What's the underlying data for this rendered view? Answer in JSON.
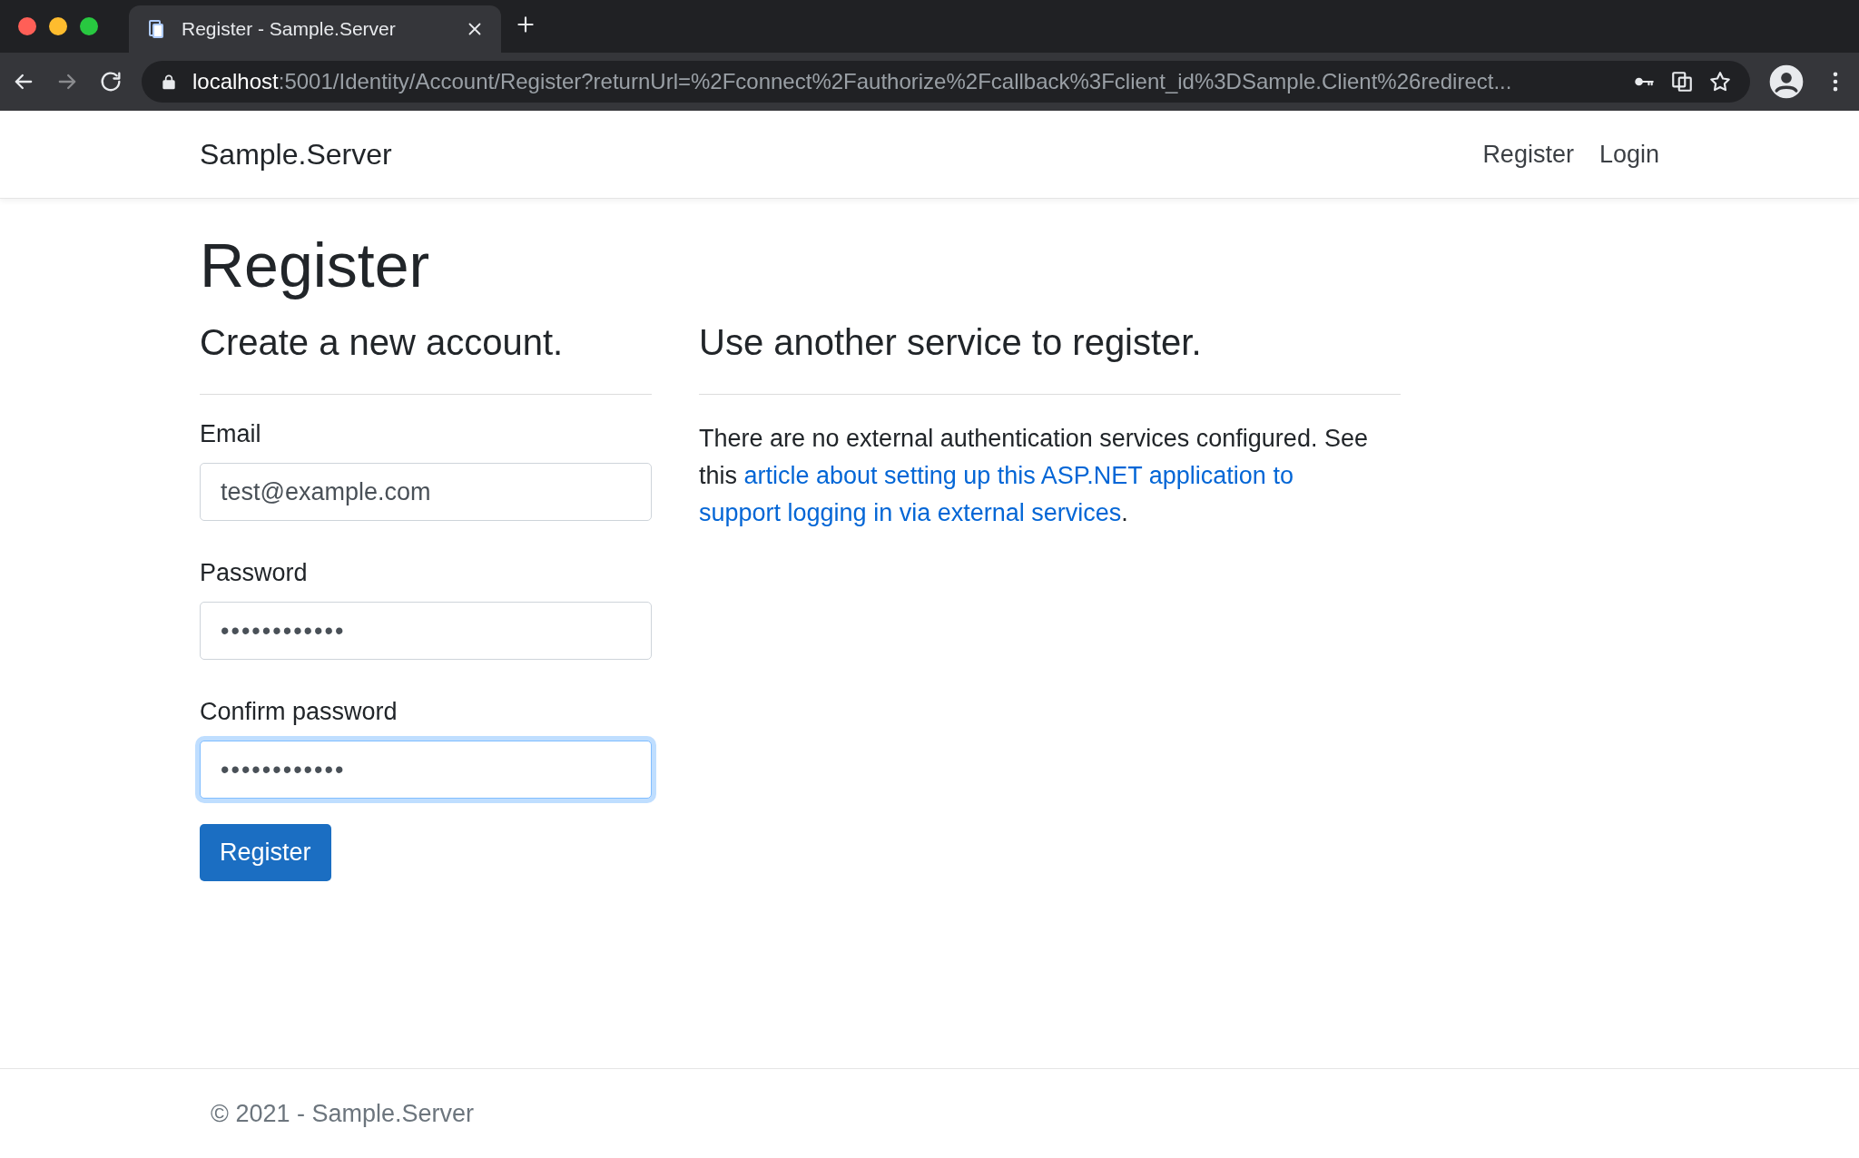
{
  "browser": {
    "tab": {
      "title": "Register - Sample.Server",
      "selected": true
    },
    "url": {
      "host": "localhost",
      "rest": ":5001/Identity/Account/Register?returnUrl=%2Fconnect%2Fauthorize%2Fcallback%3Fclient_id%3DSample.Client%26redirect..."
    }
  },
  "navbar": {
    "brand": "Sample.Server",
    "links": [
      "Register",
      "Login"
    ]
  },
  "page": {
    "title": "Register",
    "form": {
      "heading": "Create a new account.",
      "fields": [
        {
          "label": "Email",
          "kind": "email",
          "value": "test@example.com",
          "focused": false
        },
        {
          "label": "Password",
          "kind": "password",
          "value": "••••••••••••",
          "focused": false
        },
        {
          "label": "Confirm password",
          "kind": "password",
          "value": "••••••••••••",
          "focused": true
        }
      ],
      "submit": "Register"
    },
    "external": {
      "heading": "Use another service to register.",
      "text_before": "There are no external authentication services configured. See this ",
      "link_lines": [
        "article about setting up this ASP.NET application to",
        "support logging in via external services"
      ],
      "text_after": "."
    }
  },
  "footer": {
    "text": "© 2021 - Sample.Server"
  }
}
